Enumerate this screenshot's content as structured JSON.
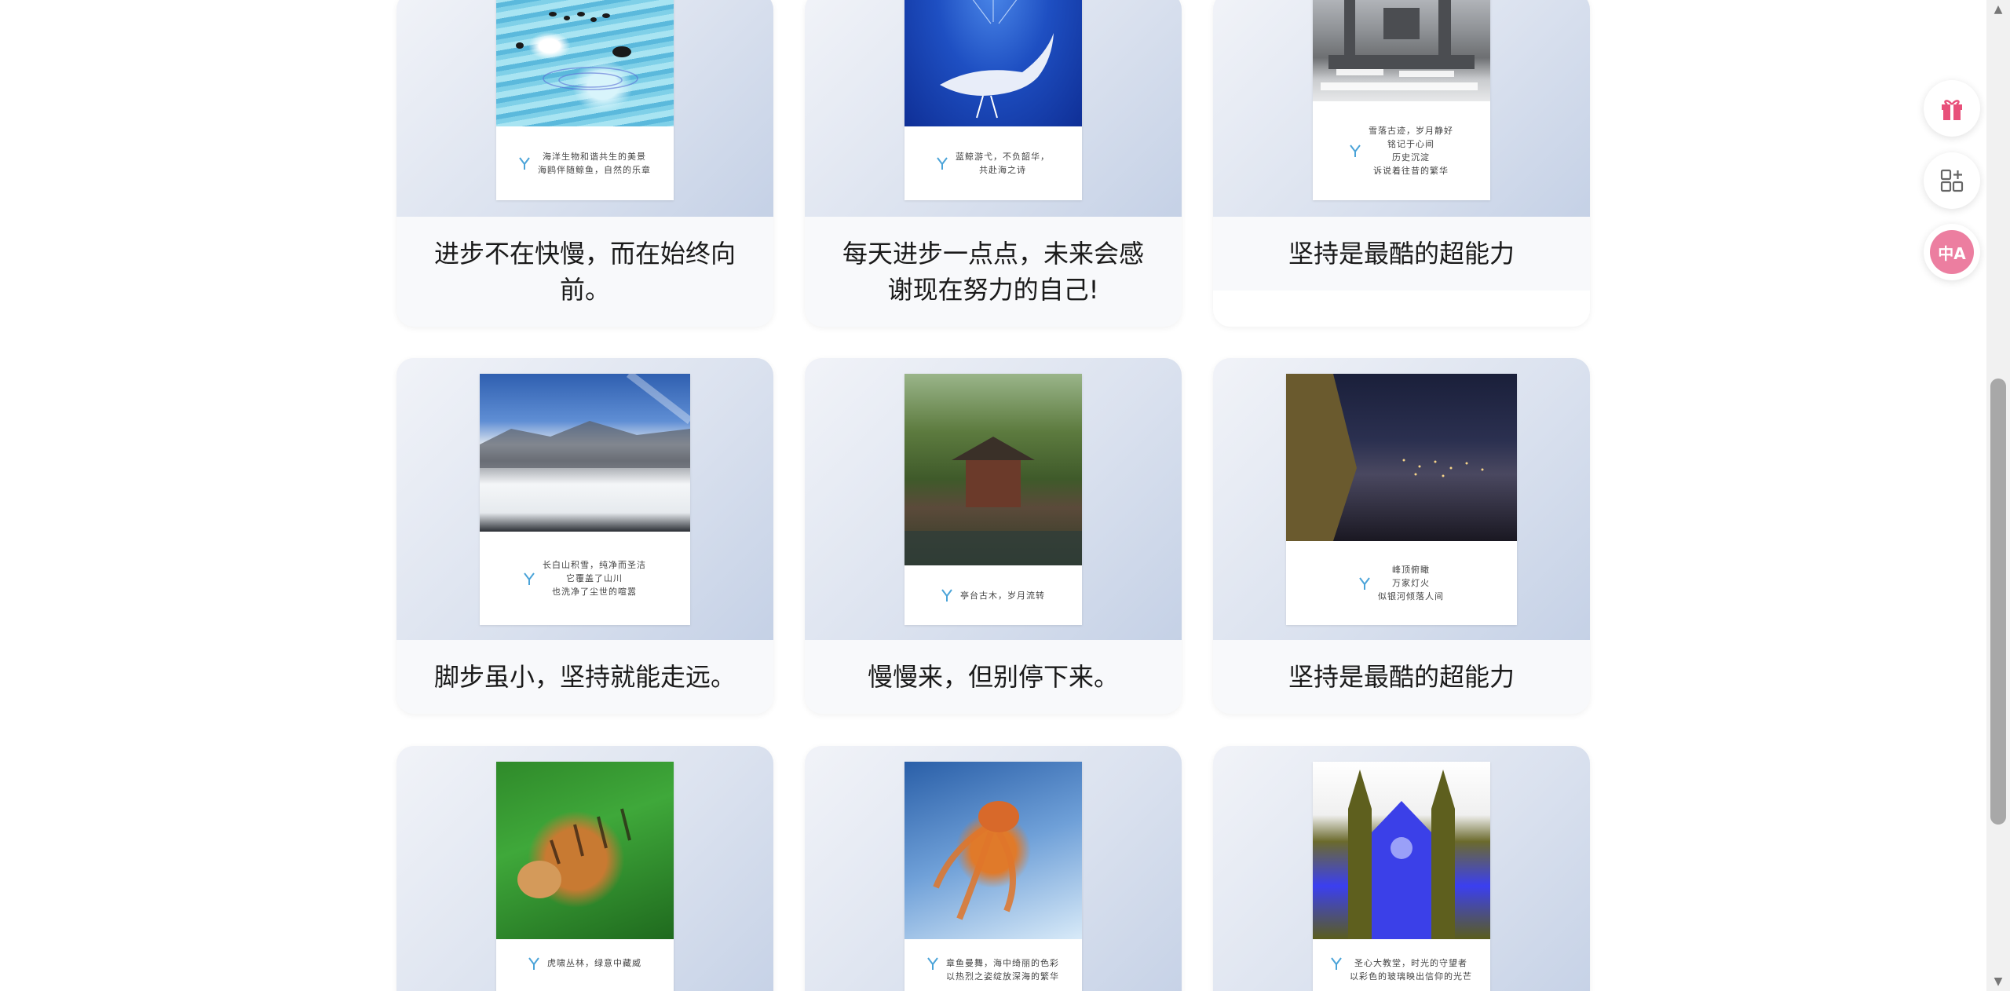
{
  "cards": [
    {
      "title": "进步不在快慢，而在始终向前。",
      "caption": "海洋生物和谐共生的美景\n海鸥伴随鲸鱼，自然的乐章",
      "image": "sea-swimmers"
    },
    {
      "title": "每天进步一点点，未来会感谢现在努力的自己!",
      "caption": "蓝鲸游弋，不负韶华，\n共赴海之诗",
      "image": "blue-whale"
    },
    {
      "title": "坚持是最酷的超能力",
      "caption": "雪落古迹，岁月静好\n铭记于心间\n历史沉淀\n诉说着往昔的繁华",
      "image": "snowy-ruins"
    },
    {
      "title": "脚步虽小，坚持就能走远。",
      "caption": "长白山积雪，纯净而圣洁\n它覆盖了山川\n也洗净了尘世的喧嚣",
      "image": "snow-mountain"
    },
    {
      "title": "慢慢来，但别停下来。",
      "caption": "亭台古木，岁月流转",
      "image": "garden-pavilion"
    },
    {
      "title": "坚持是最酷的超能力",
      "caption": "峰顶俯瞰\n万家灯火\n似银河倾落人间",
      "image": "night-city"
    },
    {
      "title": "",
      "caption": "虎啸丛林，绿意中藏威",
      "image": "tiger"
    },
    {
      "title": "",
      "caption": "章鱼曼舞，海中绮丽的色彩\n以热烈之姿绽放深海的繁华",
      "image": "octopus"
    },
    {
      "title": "",
      "caption": "圣心大教堂，时光的守望者\n以彩色的玻璃映出信仰的光芒",
      "image": "cathedral"
    }
  ],
  "toolbar": {
    "gift_icon": "gift-icon",
    "apps_icon": "apps-add-icon",
    "translate_icon": "translate-icon",
    "translate_label": "中A"
  },
  "colors": {
    "card_bg": "#f8f9fb",
    "media_gradient_start": "#f1f3f8",
    "media_gradient_end": "#c5d1e6",
    "gift_pink": "#e8507a",
    "translate_pink": "#ec7ea0"
  }
}
